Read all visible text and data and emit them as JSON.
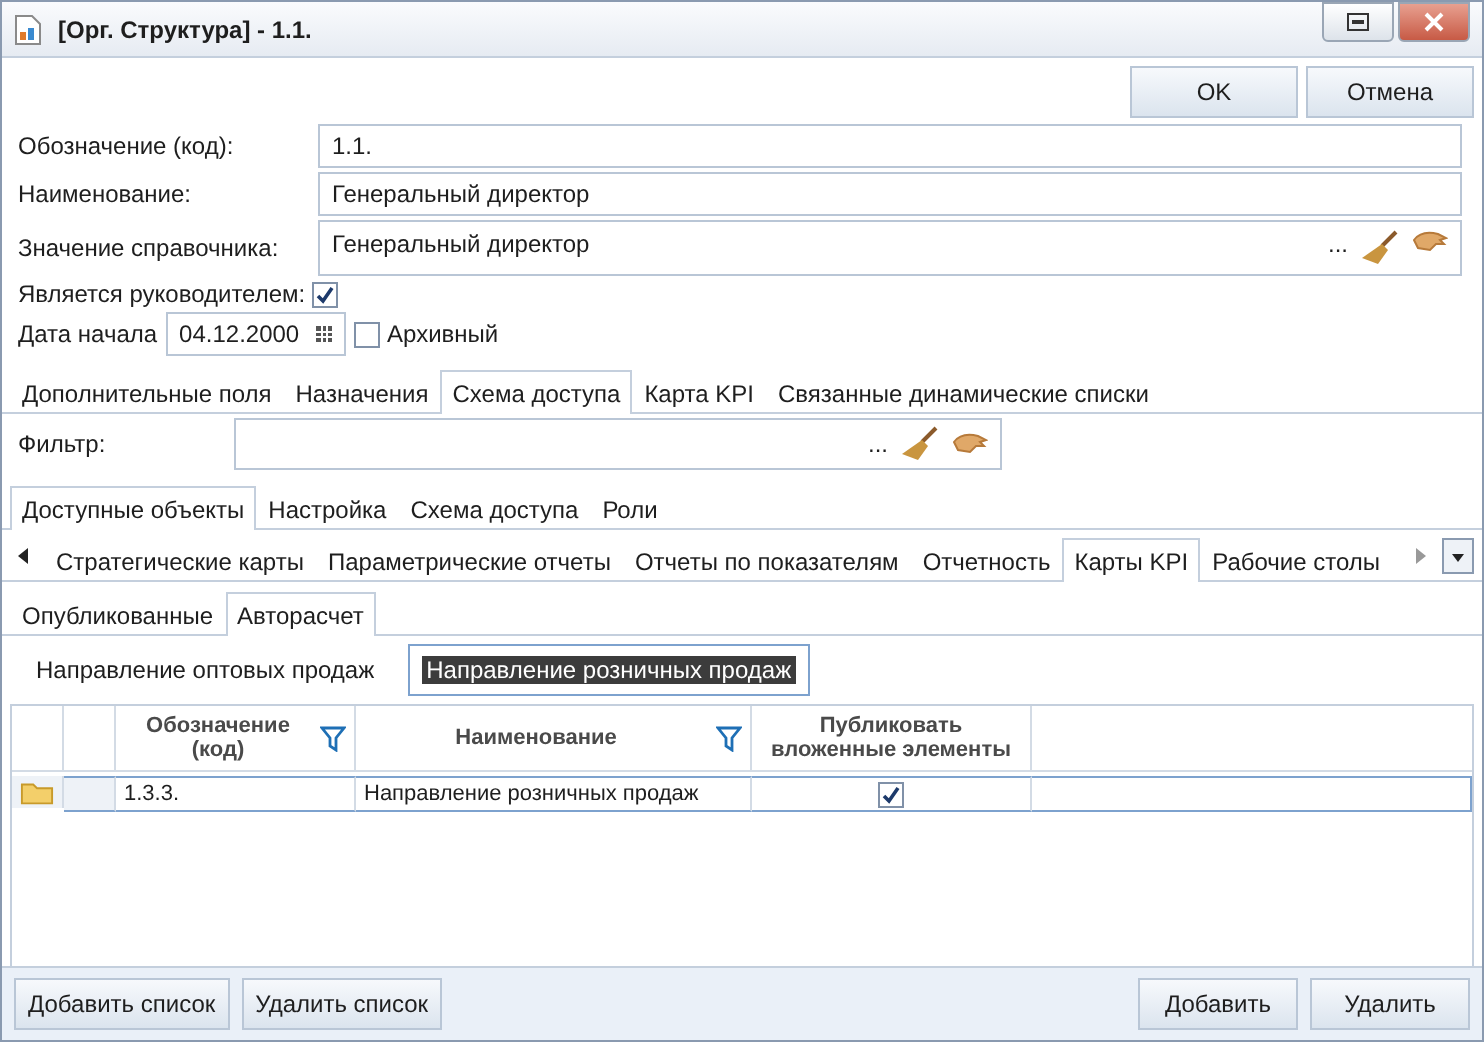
{
  "window": {
    "title": "[Орг. Структура] - 1.1."
  },
  "top_buttons": [
    "OK",
    "Отмена"
  ],
  "fields": [
    {
      "label": "Обозначение (код):",
      "value": "1.1.",
      "kind": "text"
    },
    {
      "label": "Наименование:",
      "value": "Генеральный директор",
      "kind": "text"
    },
    {
      "label": "Значение справочника:",
      "value": "Генеральный директор",
      "kind": "lookup",
      "ellipsis": "..."
    }
  ],
  "is_manager": {
    "label": "Является руководителем:",
    "checked": true
  },
  "start_date": {
    "label": "Дата начала",
    "value": "04.12.2000"
  },
  "archived": {
    "label": "Архивный",
    "checked": false
  },
  "main_tabs": [
    {
      "label": "Дополнительные поля",
      "selected": false
    },
    {
      "label": "Назначения",
      "selected": false
    },
    {
      "label": "Схема доступа",
      "selected": true
    },
    {
      "label": "Карта KPI",
      "selected": false
    },
    {
      "label": "Связанные динамические списки",
      "selected": false
    }
  ],
  "filter": {
    "label": "Фильтр:",
    "ellipsis": "..."
  },
  "object_tabs": [
    {
      "label": "Доступные объекты",
      "selected": true
    },
    {
      "label": "Настройка",
      "selected": false
    },
    {
      "label": "Схема доступа",
      "selected": false
    },
    {
      "label": "Роли",
      "selected": false
    }
  ],
  "category_tabs": [
    {
      "label": "Стратегические карты",
      "selected": false
    },
    {
      "label": "Параметрические отчеты",
      "selected": false
    },
    {
      "label": "Отчеты по показателям",
      "selected": false
    },
    {
      "label": "Отчетность",
      "selected": false
    },
    {
      "label": "Карты KPI",
      "selected": true
    },
    {
      "label": "Рабочие столы",
      "selected": false
    }
  ],
  "publish_tabs": [
    {
      "label": "Опубликованные",
      "selected": false
    },
    {
      "label": "Авторасчет",
      "selected": true
    }
  ],
  "list_tabs": [
    {
      "label": "Направление оптовых продаж",
      "selected": false
    },
    {
      "label": "Направление розничных продаж",
      "selected": true
    }
  ],
  "table": {
    "columns": [
      {
        "label": "Обозначение (код)",
        "filter": true
      },
      {
        "label": "Наименование",
        "filter": true
      },
      {
        "label": "Публиковать вложенные элементы",
        "filter": false
      }
    ],
    "rows": [
      {
        "code": "1.3.3.",
        "name": "Направление розничных продаж",
        "publish_nested": true
      }
    ]
  },
  "footer_left": [
    "Добавить список",
    "Удалить список"
  ],
  "footer_right": [
    "Добавить",
    "Удалить"
  ]
}
